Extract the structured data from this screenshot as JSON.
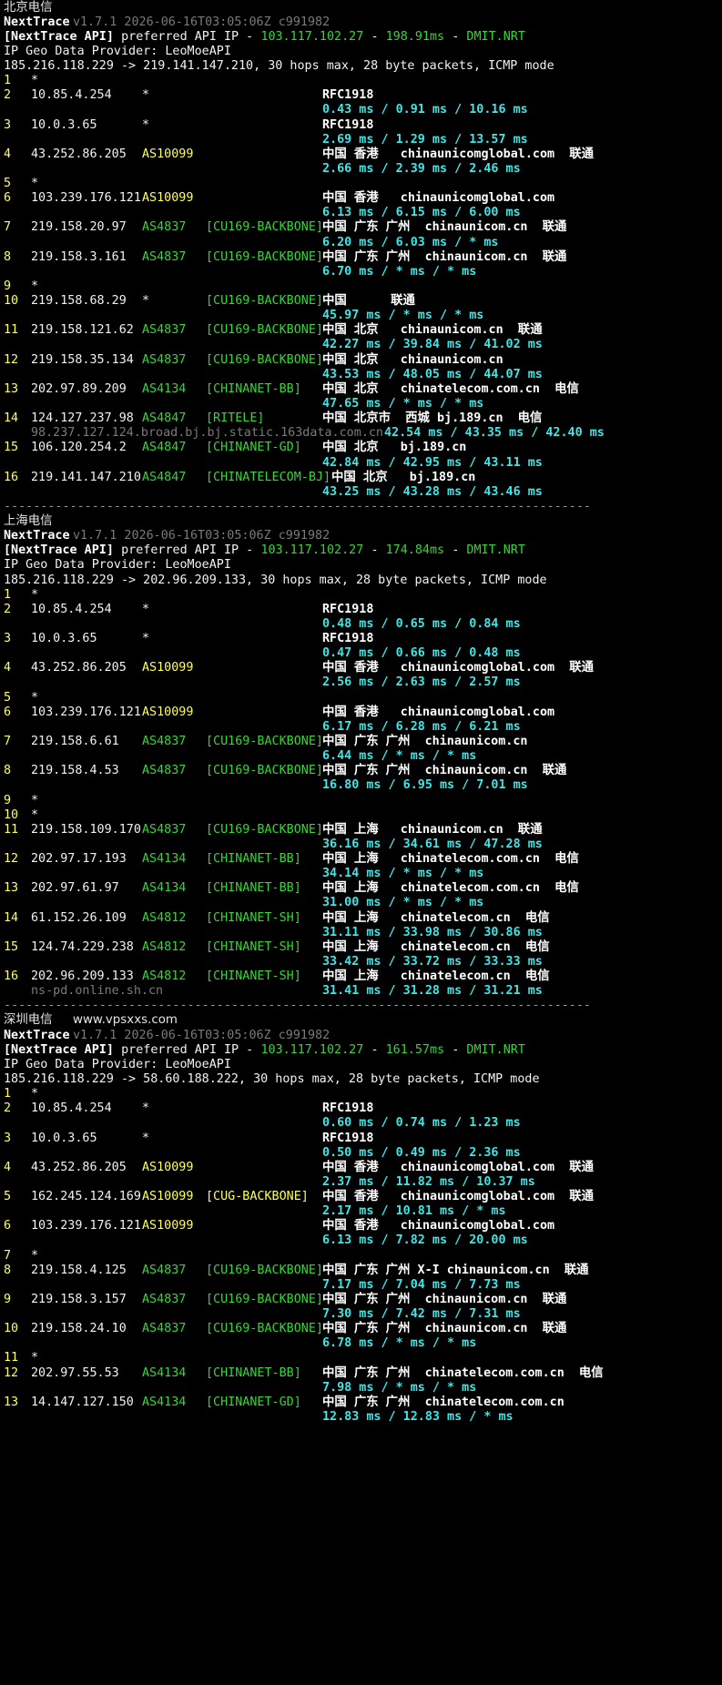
{
  "sections": [
    {
      "title": "北京电信",
      "app": "NextTrace",
      "version": "v1.7.1 2026-06-16T03:05:06Z c991982",
      "api_prefix": "[NextTrace API]",
      "api_text": " preferred API IP - ",
      "api_ip": "103.117.102.27",
      "api_dash": " - ",
      "api_ms": "198.91ms",
      "api_dash2": " - ",
      "api_node": "DMIT.NRT",
      "geo_provider": "IP Geo Data Provider: LeoMoeAPI",
      "route_line": "185.216.118.229 -> 219.141.147.210, 30 hops max, 28 byte packets, ICMP mode",
      "hops": [
        {
          "n": "1",
          "ip": "*"
        },
        {
          "n": "2",
          "ip": "10.85.4.254",
          "asn": "*",
          "geo": "RFC1918",
          "rtt": "0.43 ms / 0.91 ms / 10.16 ms"
        },
        {
          "n": "3",
          "ip": "10.0.3.65",
          "asn": "*",
          "geo": "RFC1918",
          "rtt": "2.69 ms / 1.29 ms / 13.57 ms"
        },
        {
          "n": "4",
          "ip": "43.252.86.205",
          "asn": "AS10099",
          "geo": "中国 香港   chinaunicomglobal.com  联通",
          "rtt": "2.66 ms / 2.39 ms / 2.46 ms"
        },
        {
          "n": "5",
          "ip": "*"
        },
        {
          "n": "6",
          "ip": "103.239.176.121",
          "asn": "AS10099",
          "geo": "中国 香港   chinaunicomglobal.com",
          "rtt": "6.13 ms / 6.15 ms / 6.00 ms"
        },
        {
          "n": "7",
          "ip": "219.158.20.97",
          "asn": "AS4837",
          "tag": "[CU169-BACKBONE]",
          "geo": "中国 广东 广州  chinaunicom.cn  联通",
          "rtt": "6.20 ms / 6.03 ms / * ms"
        },
        {
          "n": "8",
          "ip": "219.158.3.161",
          "asn": "AS4837",
          "tag": "[CU169-BACKBONE]",
          "geo": "中国 广东 广州  chinaunicom.cn  联通",
          "rtt": "6.70 ms / * ms / * ms"
        },
        {
          "n": "9",
          "ip": "*"
        },
        {
          "n": "10",
          "ip": "219.158.68.29",
          "asn": "*",
          "tag": "[CU169-BACKBONE]",
          "geo": "中国      联通",
          "rtt": "45.97 ms / * ms / * ms"
        },
        {
          "n": "11",
          "ip": "219.158.121.62",
          "asn": "AS4837",
          "tag": "[CU169-BACKBONE]",
          "geo": "中国 北京   chinaunicom.cn  联通",
          "rtt": "42.27 ms / 39.84 ms / 41.02 ms"
        },
        {
          "n": "12",
          "ip": "219.158.35.134",
          "asn": "AS4837",
          "tag": "[CU169-BACKBONE]",
          "geo": "中国 北京   chinaunicom.cn",
          "rtt": "43.53 ms / 48.05 ms / 44.07 ms"
        },
        {
          "n": "13",
          "ip": "202.97.89.209",
          "asn": "AS4134",
          "tag": "[CHINANET-BB]",
          "geo": "中国 北京   chinatelecom.com.cn  电信",
          "rtt": "47.65 ms / * ms / * ms"
        },
        {
          "n": "14",
          "ip": "124.127.237.98",
          "asn": "AS4847",
          "tag": "[RITELE]",
          "geo": "中国 北京市  西城 bj.189.cn  电信",
          "rdns": "98.237.127.124.broad.bj.bj.static.163data.com.cn",
          "rtt": "42.54 ms / 43.35 ms / 42.40 ms",
          "rtt_inline": true
        },
        {
          "n": "15",
          "ip": "106.120.254.2",
          "asn": "AS4847",
          "tag": "[CHINANET-GD]",
          "geo": "中国 北京   bj.189.cn",
          "rtt": "42.84 ms / 42.95 ms / 43.11 ms"
        },
        {
          "n": "16",
          "ip": "219.141.147.210",
          "asn": "AS4847",
          "tag": "[CHINATELECOM-BJ]",
          "geo": "中国 北京   bj.189.cn",
          "rtt": "43.25 ms / 43.28 ms / 43.46 ms",
          "geo_shift": true
        }
      ]
    },
    {
      "title": "上海电信",
      "app": "NextTrace",
      "version": "v1.7.1 2026-06-16T03:05:06Z c991982",
      "api_prefix": "[NextTrace API]",
      "api_text": " preferred API IP - ",
      "api_ip": "103.117.102.27",
      "api_dash": " - ",
      "api_ms": "174.84ms",
      "api_dash2": " - ",
      "api_node": "DMIT.NRT",
      "geo_provider": "IP Geo Data Provider: LeoMoeAPI",
      "route_line": "185.216.118.229 -> 202.96.209.133, 30 hops max, 28 byte packets, ICMP mode",
      "hops": [
        {
          "n": "1",
          "ip": "*"
        },
        {
          "n": "2",
          "ip": "10.85.4.254",
          "asn": "*",
          "geo": "RFC1918",
          "rtt": "0.48 ms / 0.65 ms / 0.84 ms"
        },
        {
          "n": "3",
          "ip": "10.0.3.65",
          "asn": "*",
          "geo": "RFC1918",
          "rtt": "0.47 ms / 0.66 ms / 0.48 ms"
        },
        {
          "n": "4",
          "ip": "43.252.86.205",
          "asn": "AS10099",
          "geo": "中国 香港   chinaunicomglobal.com  联通",
          "rtt": "2.56 ms / 2.63 ms / 2.57 ms"
        },
        {
          "n": "5",
          "ip": "*"
        },
        {
          "n": "6",
          "ip": "103.239.176.121",
          "asn": "AS10099",
          "geo": "中国 香港   chinaunicomglobal.com",
          "rtt": "6.17 ms / 6.28 ms / 6.21 ms"
        },
        {
          "n": "7",
          "ip": "219.158.6.61",
          "asn": "AS4837",
          "tag": "[CU169-BACKBONE]",
          "geo": "中国 广东 广州  chinaunicom.cn",
          "rtt": "6.44 ms / * ms / * ms"
        },
        {
          "n": "8",
          "ip": "219.158.4.53",
          "asn": "AS4837",
          "tag": "[CU169-BACKBONE]",
          "geo": "中国 广东 广州  chinaunicom.cn  联通",
          "rtt": "16.80 ms / 6.95 ms / 7.01 ms"
        },
        {
          "n": "9",
          "ip": "*"
        },
        {
          "n": "10",
          "ip": "*"
        },
        {
          "n": "11",
          "ip": "219.158.109.170",
          "asn": "AS4837",
          "tag": "[CU169-BACKBONE]",
          "geo": "中国 上海   chinaunicom.cn  联通",
          "rtt": "36.16 ms / 34.61 ms / 47.28 ms"
        },
        {
          "n": "12",
          "ip": "202.97.17.193",
          "asn": "AS4134",
          "tag": "[CHINANET-BB]",
          "geo": "中国 上海   chinatelecom.com.cn  电信",
          "rtt": "34.14 ms / * ms / * ms"
        },
        {
          "n": "13",
          "ip": "202.97.61.97",
          "asn": "AS4134",
          "tag": "[CHINANET-BB]",
          "geo": "中国 上海   chinatelecom.com.cn  电信",
          "rtt": "31.00 ms / * ms / * ms"
        },
        {
          "n": "14",
          "ip": "61.152.26.109",
          "asn": "AS4812",
          "tag": "[CHINANET-SH]",
          "geo": "中国 上海   chinatelecom.cn  电信",
          "rtt": "31.11 ms / 33.98 ms / 30.86 ms"
        },
        {
          "n": "15",
          "ip": "124.74.229.238",
          "asn": "AS4812",
          "tag": "[CHINANET-SH]",
          "geo": "中国 上海   chinatelecom.cn  电信",
          "rtt": "33.42 ms / 33.72 ms / 33.33 ms"
        },
        {
          "n": "16",
          "ip": "202.96.209.133",
          "asn": "AS4812",
          "tag": "[CHINANET-SH]",
          "geo": "中国 上海   chinatelecom.cn  电信",
          "rdns": "ns-pd.online.sh.cn",
          "rtt": "31.41 ms / 31.28 ms / 31.21 ms",
          "rtt_inline": true
        }
      ]
    },
    {
      "title": "深圳电信",
      "watermark": "www.vpsxxs.com",
      "app": "NextTrace",
      "version": "v1.7.1 2026-06-16T03:05:06Z c991982",
      "api_prefix": "[NextTrace API]",
      "api_text": " preferred API IP - ",
      "api_ip": "103.117.102.27",
      "api_dash": " - ",
      "api_ms": "161.57ms",
      "api_dash2": " - ",
      "api_node": "DMIT.NRT",
      "geo_provider": "IP Geo Data Provider: LeoMoeAPI",
      "route_line": "185.216.118.229 -> 58.60.188.222, 30 hops max, 28 byte packets, ICMP mode",
      "hops": [
        {
          "n": "1",
          "ip": "*"
        },
        {
          "n": "2",
          "ip": "10.85.4.254",
          "asn": "*",
          "geo": "RFC1918",
          "rtt": "0.60 ms / 0.74 ms / 1.23 ms"
        },
        {
          "n": "3",
          "ip": "10.0.3.65",
          "asn": "*",
          "geo": "RFC1918",
          "rtt": "0.50 ms / 0.49 ms / 2.36 ms"
        },
        {
          "n": "4",
          "ip": "43.252.86.205",
          "asn": "AS10099",
          "geo": "中国 香港   chinaunicomglobal.com  联通",
          "rtt": "2.37 ms / 11.82 ms / 10.37 ms"
        },
        {
          "n": "5",
          "ip": "162.245.124.169",
          "asn": "AS10099",
          "tag": "[CUG-BACKBONE]",
          "tag_color": "yel",
          "geo": "中国 香港   chinaunicomglobal.com  联通",
          "rtt": "2.17 ms / 10.81 ms / * ms"
        },
        {
          "n": "6",
          "ip": "103.239.176.121",
          "asn": "AS10099",
          "geo": "中国 香港   chinaunicomglobal.com",
          "rtt": "6.13 ms / 7.82 ms / 20.00 ms"
        },
        {
          "n": "7",
          "ip": "*"
        },
        {
          "n": "8",
          "ip": "219.158.4.125",
          "asn": "AS4837",
          "tag": "[CU169-BACKBONE]",
          "geo": "中国 广东 广州 X-I chinaunicom.cn  联通",
          "rtt": "7.17 ms / 7.04 ms / 7.73 ms"
        },
        {
          "n": "9",
          "ip": "219.158.3.157",
          "asn": "AS4837",
          "tag": "[CU169-BACKBONE]",
          "geo": "中国 广东 广州  chinaunicom.cn  联通",
          "rtt": "7.30 ms / 7.42 ms / 7.31 ms"
        },
        {
          "n": "10",
          "ip": "219.158.24.10",
          "asn": "AS4837",
          "tag": "[CU169-BACKBONE]",
          "geo": "中国 广东 广州  chinaunicom.cn  联通",
          "rtt": "6.78 ms / * ms / * ms"
        },
        {
          "n": "11",
          "ip": "*"
        },
        {
          "n": "12",
          "ip": "202.97.55.53",
          "asn": "AS4134",
          "tag": "[CHINANET-BB]",
          "geo": "中国 广东 广州  chinatelecom.com.cn  电信",
          "rtt": "7.98 ms / * ms / * ms"
        },
        {
          "n": "13",
          "ip": "14.147.127.150",
          "asn": "AS4134",
          "tag": "[CHINANET-GD]",
          "geo": "中国 广东 广州  chinatelecom.com.cn",
          "rtt": "12.83 ms / 12.83 ms / * ms"
        }
      ]
    }
  ],
  "separator": "--------------------------------------------------------------------------------",
  "colors": {
    "asn_as10099": "#ffff55",
    "asn_other": "#35d635",
    "rtt": "#3ee6e6",
    "hop_num": "#ffff55"
  }
}
